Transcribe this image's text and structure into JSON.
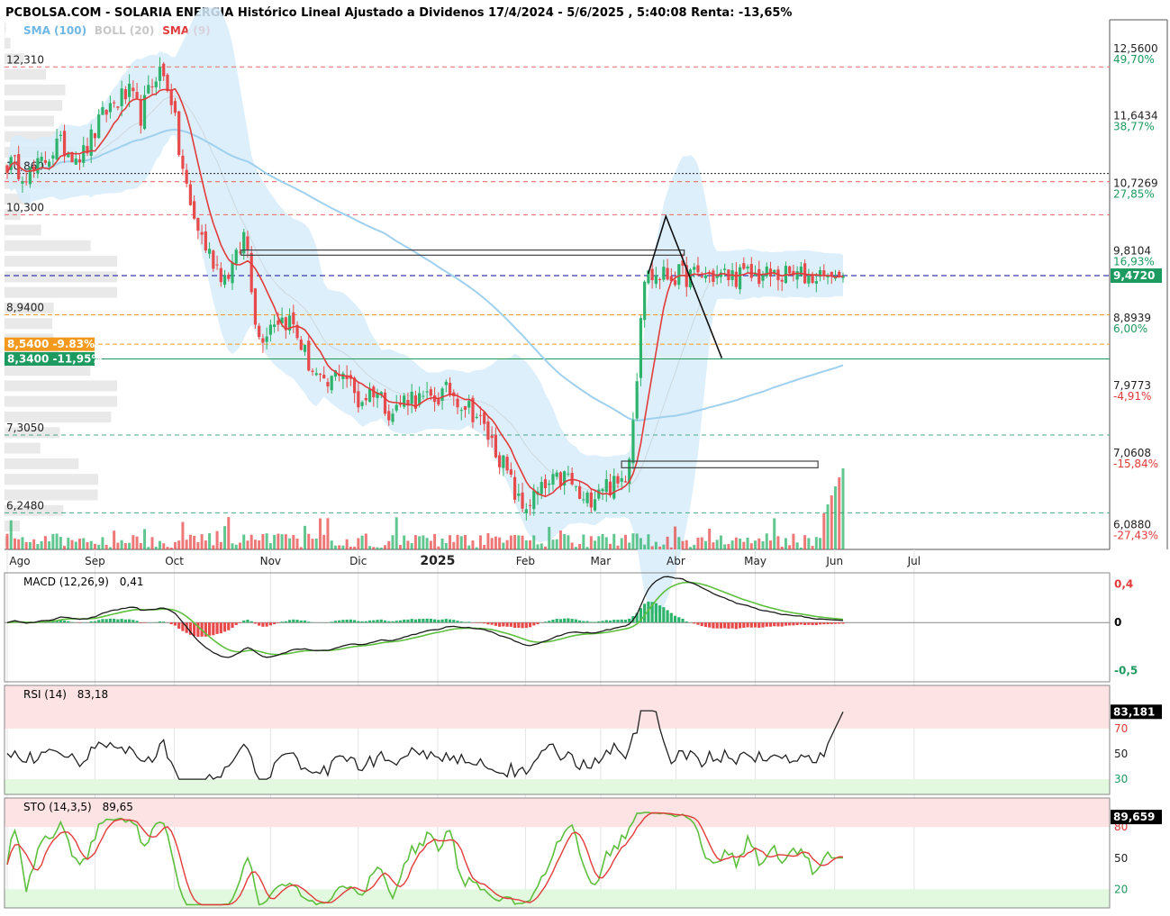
{
  "header": {
    "title": "PCBOLSA.COM - SOLARIA ENERGIA Histórico Lineal Ajustado a Dividenos 17/4/2024 - 5/6/2025 , 5:40:08 Renta: -13,65%",
    "legend_sma100": "SMA (100)",
    "legend_boll": "BOLL (20)",
    "legend_sma9": "SMA (9)"
  },
  "colors": {
    "up": "#2db36b",
    "down": "#e8494a",
    "sma9": "#e23b3b",
    "sma100": "#9fd0ee",
    "boll": "#d6ecfa",
    "macd_line": "#1b1b1b",
    "signal_line": "#5fbf3f",
    "fib": "#f39a1e",
    "dark_green": "#1d9a5f"
  },
  "chart_data": [
    {
      "type": "candlestick",
      "name": "price",
      "x_labels": [
        "Ago",
        "Sep",
        "Oct",
        "Nov",
        "Dic",
        "2025",
        "Feb",
        "Mar",
        "Abr",
        "May",
        "Jun",
        "Jul"
      ],
      "ylim": [
        5.75,
        12.95
      ],
      "right_axis": [
        {
          "value": 12.56,
          "label": "12,5600",
          "pct": "49,70%",
          "sign": "pos"
        },
        {
          "value": 11.6434,
          "label": "11,6434",
          "pct": "38,77%",
          "sign": "pos"
        },
        {
          "value": 10.7269,
          "label": "10,7269",
          "pct": "27,85%",
          "sign": "pos"
        },
        {
          "value": 9.8104,
          "label": "9,8104",
          "pct": "16,93%",
          "sign": "pos"
        },
        {
          "value": 8.8939,
          "label": "8,8939",
          "pct": "6,00%",
          "sign": "pos"
        },
        {
          "value": 7.9773,
          "label": "7,9773",
          "pct": "-4,91%",
          "sign": "neg"
        },
        {
          "value": 7.0608,
          "label": "7,0608",
          "pct": "-15,84%",
          "sign": "neg"
        },
        {
          "value": 6.088,
          "label": "6,0880",
          "pct": "-27,43%",
          "sign": "neg"
        }
      ],
      "last_price": {
        "value": 9.472,
        "label": "9,4720"
      },
      "left_levels": [
        {
          "value": 12.31,
          "label": "12,310",
          "style": "red"
        },
        {
          "value": 10.86,
          "label": "10,860",
          "style": "black"
        },
        {
          "value": 10.3,
          "label": "10,300",
          "style": "red"
        },
        {
          "value": 8.94,
          "label": "8,9400",
          "style": "orange"
        },
        {
          "value": 7.305,
          "label": "7,3050",
          "style": "teal"
        },
        {
          "value": 6.248,
          "label": "6,2480",
          "style": "teal"
        }
      ],
      "extra_lines": [
        {
          "value": 10.75,
          "style": "red"
        },
        {
          "value": 9.472,
          "style": "blue"
        }
      ],
      "badges": [
        {
          "value": 8.54,
          "label": "8,5400 -9.83%",
          "color": "#f39a1e"
        },
        {
          "value": 8.34,
          "label": "8,3400 -11,95%",
          "color": "#1d9a5f"
        }
      ],
      "zones": [
        {
          "from": 0.28,
          "to": 0.81,
          "top": 9.82,
          "bottom": 9.75
        },
        {
          "from": 0.735,
          "to": 0.97,
          "top": 6.95,
          "bottom": 6.86
        }
      ],
      "projection": [
        {
          "t": 0.767,
          "v": 9.5
        },
        {
          "t": 0.788,
          "v": 10.28
        },
        {
          "t": 0.855,
          "v": 8.35
        }
      ],
      "anchors": [
        {
          "t": 0.0,
          "v": 11.0
        },
        {
          "t": 0.03,
          "v": 10.85
        },
        {
          "t": 0.06,
          "v": 11.25
        },
        {
          "t": 0.09,
          "v": 11.1
        },
        {
          "t": 0.12,
          "v": 11.75
        },
        {
          "t": 0.145,
          "v": 11.95
        },
        {
          "t": 0.16,
          "v": 11.65
        },
        {
          "t": 0.18,
          "v": 12.3
        },
        {
          "t": 0.195,
          "v": 12.0
        },
        {
          "t": 0.205,
          "v": 11.2
        },
        {
          "t": 0.22,
          "v": 10.35
        },
        {
          "t": 0.24,
          "v": 9.8
        },
        {
          "t": 0.26,
          "v": 9.45
        },
        {
          "t": 0.275,
          "v": 9.7
        },
        {
          "t": 0.285,
          "v": 10.1
        },
        {
          "t": 0.3,
          "v": 8.6
        },
        {
          "t": 0.32,
          "v": 8.9
        },
        {
          "t": 0.34,
          "v": 8.85
        },
        {
          "t": 0.36,
          "v": 8.3
        },
        {
          "t": 0.38,
          "v": 7.9
        },
        {
          "t": 0.4,
          "v": 8.25
        },
        {
          "t": 0.42,
          "v": 7.75
        },
        {
          "t": 0.44,
          "v": 7.95
        },
        {
          "t": 0.46,
          "v": 7.6
        },
        {
          "t": 0.48,
          "v": 7.85
        },
        {
          "t": 0.5,
          "v": 7.75
        },
        {
          "t": 0.53,
          "v": 7.9
        },
        {
          "t": 0.56,
          "v": 7.6
        },
        {
          "t": 0.59,
          "v": 7.0
        },
        {
          "t": 0.615,
          "v": 6.3
        },
        {
          "t": 0.64,
          "v": 6.55
        },
        {
          "t": 0.67,
          "v": 6.75
        },
        {
          "t": 0.69,
          "v": 6.35
        },
        {
          "t": 0.71,
          "v": 6.65
        },
        {
          "t": 0.73,
          "v": 6.6
        },
        {
          "t": 0.74,
          "v": 6.8
        },
        {
          "t": 0.745,
          "v": 7.15
        },
        {
          "t": 0.75,
          "v": 7.7
        },
        {
          "t": 0.755,
          "v": 8.35
        },
        {
          "t": 0.76,
          "v": 9.47
        }
      ]
    },
    {
      "type": "histogram",
      "name": "MACD",
      "title": "MACD (12,26,9)",
      "last": "0,41",
      "ylim": [
        -0.62,
        0.52
      ],
      "ticks": [
        {
          "value": 0.4,
          "label": "0,4",
          "color": "#e23b3b"
        },
        {
          "value": 0.0,
          "label": "0",
          "color": "#000000"
        },
        {
          "value": -0.5,
          "label": "-0,5",
          "color": "#1d9a5f"
        }
      ]
    },
    {
      "type": "line",
      "name": "RSI",
      "title": "RSI (14)",
      "last": "83,18",
      "current": {
        "value": 83.181,
        "label": "83,181"
      },
      "ylim": [
        18,
        104
      ],
      "ticks": [
        {
          "value": 70,
          "label": "70",
          "color": "#e23b3b"
        },
        {
          "value": 50,
          "label": "50",
          "color": "#222222"
        },
        {
          "value": 30,
          "label": "30",
          "color": "#1d9a5f"
        }
      ]
    },
    {
      "type": "line",
      "name": "STO",
      "title": "STO (14,3,5)",
      "last": "89,65",
      "current": {
        "value": 89.659,
        "label": "89,659"
      },
      "ylim": [
        2,
        108
      ],
      "ticks": [
        {
          "value": 80,
          "label": "80",
          "color": "#e23b3b"
        },
        {
          "value": 50,
          "label": "50",
          "color": "#222222"
        },
        {
          "value": 20,
          "label": "20",
          "color": "#1d9a5f"
        }
      ]
    }
  ]
}
